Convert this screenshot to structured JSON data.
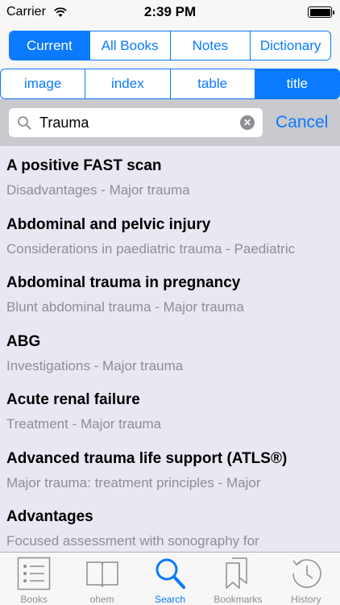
{
  "status_bar": {
    "carrier": "Carrier",
    "time": "2:39 PM"
  },
  "scope_segments": [
    {
      "label": "Current",
      "active": true
    },
    {
      "label": "All Books",
      "active": false
    },
    {
      "label": "Notes",
      "active": false
    },
    {
      "label": "Dictionary",
      "active": false
    }
  ],
  "type_segments": [
    {
      "label": "image",
      "active": false
    },
    {
      "label": "index",
      "active": false
    },
    {
      "label": "table",
      "active": false
    },
    {
      "label": "title",
      "active": true
    }
  ],
  "search": {
    "value": "Trauma",
    "cancel_label": "Cancel"
  },
  "results": [
    {
      "title": "A positive FAST scan",
      "subtitle": "Disadvantages - Major trauma"
    },
    {
      "title": "Abdominal and pelvic injury",
      "subtitle": "Considerations in paediatric trauma - Paediatric"
    },
    {
      "title": "Abdominal trauma in pregnancy",
      "subtitle": "Blunt abdominal trauma - Major trauma"
    },
    {
      "title": "ABG",
      "subtitle": "Investigations - Major trauma"
    },
    {
      "title": "Acute renal failure",
      "subtitle": "Treatment - Major trauma"
    },
    {
      "title": "Advanced trauma life support (ATLS®)",
      "subtitle": "Major trauma: treatment principles - Major"
    },
    {
      "title": "Advantages",
      "subtitle": "Focused assessment with sonography for"
    }
  ],
  "tabs": [
    {
      "label": "Books",
      "icon": "list-icon",
      "active": false
    },
    {
      "label": "ohem",
      "icon": "open-book-icon",
      "active": false
    },
    {
      "label": "Search",
      "icon": "search-icon",
      "active": true
    },
    {
      "label": "Bookmarks",
      "icon": "bookmarks-icon",
      "active": false
    },
    {
      "label": "History",
      "icon": "history-clock-icon",
      "active": false
    }
  ],
  "colors": {
    "accent": "#0a7aff",
    "results_bg": "#e9e7f1",
    "subtitle": "#8e8e93"
  }
}
